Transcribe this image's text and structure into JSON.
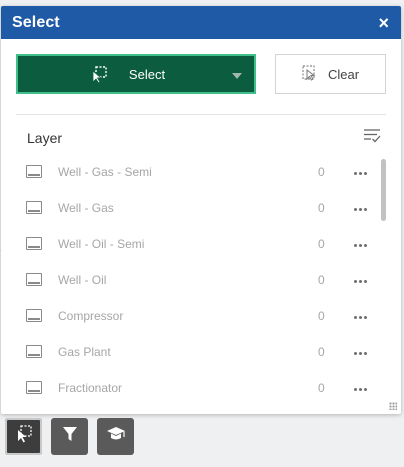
{
  "panel": {
    "title": "Select",
    "close_glyph": "×",
    "select_button": {
      "label": "Select",
      "icon": "select-cursor-icon"
    },
    "clear_button": {
      "label": "Clear",
      "icon": "clear-selection-icon"
    },
    "layer_header": {
      "label": "Layer",
      "icon": "filter-list-icon"
    },
    "layers": [
      {
        "name": "Well - Gas - Semi",
        "count": "0"
      },
      {
        "name": "Well - Gas",
        "count": "0"
      },
      {
        "name": "Well - Oil - Semi",
        "count": "0"
      },
      {
        "name": "Well - Oil",
        "count": "0"
      },
      {
        "name": "Compressor",
        "count": "0"
      },
      {
        "name": "Gas Plant",
        "count": "0"
      },
      {
        "name": "Fractionator",
        "count": "0"
      }
    ]
  },
  "dock": [
    {
      "icon": "select-tool-icon",
      "active": true
    },
    {
      "icon": "filter-icon",
      "active": false
    },
    {
      "icon": "graduation-cap-icon",
      "active": false
    }
  ],
  "colors": {
    "header": "#1e5aa6",
    "select_button_bg": "#0c5d3f",
    "select_button_border": "#3fbf8a",
    "dock_button": "#5a5a5a"
  }
}
